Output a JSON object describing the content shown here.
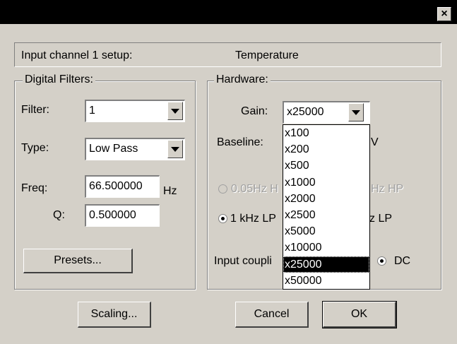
{
  "window": {
    "close_glyph": "×"
  },
  "info": {
    "label": "Input channel 1 setup:",
    "value": "Temperature"
  },
  "digital_filters": {
    "title": "Digital Filters:",
    "filter_label": "Filter:",
    "filter_value": "1",
    "type_label": "Type:",
    "type_value": "Low Pass",
    "freq_label": "Freq:",
    "freq_value": "66.500000",
    "freq_unit": "Hz",
    "q_label": "Q:",
    "q_value": "0.500000",
    "presets_label": "Presets..."
  },
  "hardware": {
    "title": "Hardware:",
    "gain_label": "Gain:",
    "gain_value": "x25000",
    "baseline_label": "Baseline:",
    "baseline_tail": "V",
    "hp_left": "0.05Hz H",
    "hp_right": "Hz HP",
    "lp_left": "1 kHz LP",
    "lp_right": "z LP",
    "coupling_label": "Input coupli",
    "dc_label": "DC",
    "gain_options": [
      "x100",
      "x200",
      "x500",
      "x1000",
      "x2000",
      "x2500",
      "x5000",
      "x10000",
      "x25000",
      "x50000"
    ],
    "gain_selected": "x25000"
  },
  "buttons": {
    "scaling": "Scaling...",
    "cancel": "Cancel",
    "ok": "OK"
  }
}
